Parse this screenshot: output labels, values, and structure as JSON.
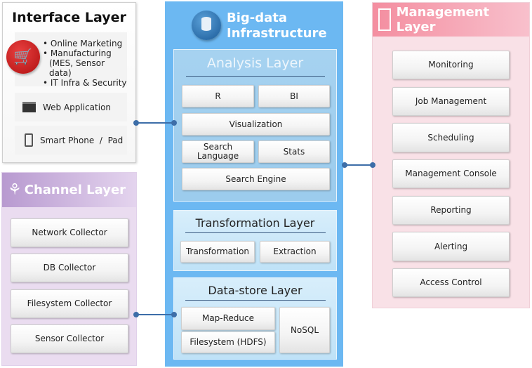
{
  "interface_layer": {
    "title": "Interface Layer",
    "bullets": [
      "Online Marketing",
      "Manufacturing",
      "(MES, Sensor data)",
      "IT Infra & Security"
    ],
    "items": [
      "Web Application",
      "Smart Phone  /  Pad"
    ]
  },
  "channel_layer": {
    "title": "Channel Layer",
    "items": [
      "Network Collector",
      "DB Collector",
      "Filesystem Collector",
      "Sensor Collector"
    ]
  },
  "bigdata": {
    "title_line1": "Big-data",
    "title_line2": "Infrastructure",
    "analysis": {
      "title": "Analysis Layer",
      "items": [
        "R",
        "BI",
        "Visualization",
        "Search Language",
        "Stats",
        "Search Engine"
      ]
    },
    "transformation": {
      "title": "Transformation Layer",
      "items": [
        "Transformation",
        "Extraction"
      ]
    },
    "datastore": {
      "title": "Data-store Layer",
      "items": [
        "Map-Reduce",
        "Filesystem (HDFS)",
        "NoSQL"
      ]
    }
  },
  "management_layer": {
    "title": "Management Layer",
    "items": [
      "Monitoring",
      "Job Management",
      "Scheduling",
      "Management Console",
      "Reporting",
      "Alerting",
      "Access Control"
    ]
  },
  "colors": {
    "bigdata_bg": "#6cb8f2",
    "channel_bg": "#eadcf0",
    "management_bg": "#f9e1e7",
    "connector": "#3d6ea8"
  }
}
